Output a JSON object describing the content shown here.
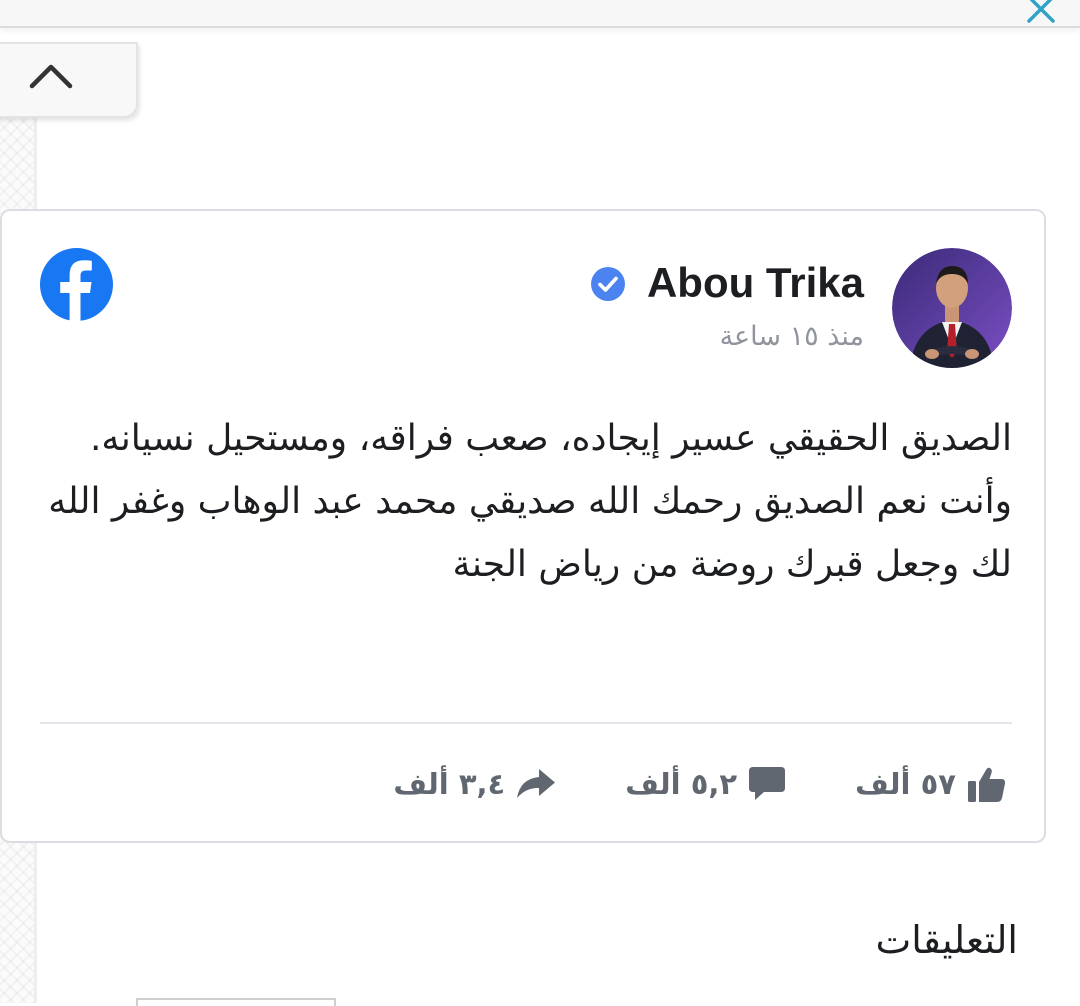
{
  "post": {
    "author_name": "Abou Trika",
    "time_ago": "منذ ١٥ ساعة",
    "text_paragraph_1": "الصديق الحقيقي عسير إيجاده، صعب فراقه، ومستحيل نسيانه.",
    "text_paragraph_2": "وأنت نعم الصديق رحمك الله صديقي محمد عبد الوهاب وغفر الله لك وجعل قبرك روضة من رياض الجنة",
    "likes_count": "٥٧ ألف",
    "comments_count": "٥,٢ ألف",
    "shares_count": "٣,٤ ألف"
  },
  "comments": {
    "heading": "التعليقات"
  },
  "icons": {
    "close": "close-icon",
    "collapse": "chevron-up-icon",
    "verified": "verified-badge-icon",
    "facebook": "facebook-logo-icon",
    "like": "thumbs-up-icon",
    "comment": "comment-icon",
    "share": "share-arrow-icon"
  },
  "colors": {
    "facebook_blue": "#1877f2",
    "verified_blue": "#4b83f0",
    "text_primary": "#1c1e21",
    "text_secondary": "#606770",
    "close_teal": "#2fa3c5"
  }
}
